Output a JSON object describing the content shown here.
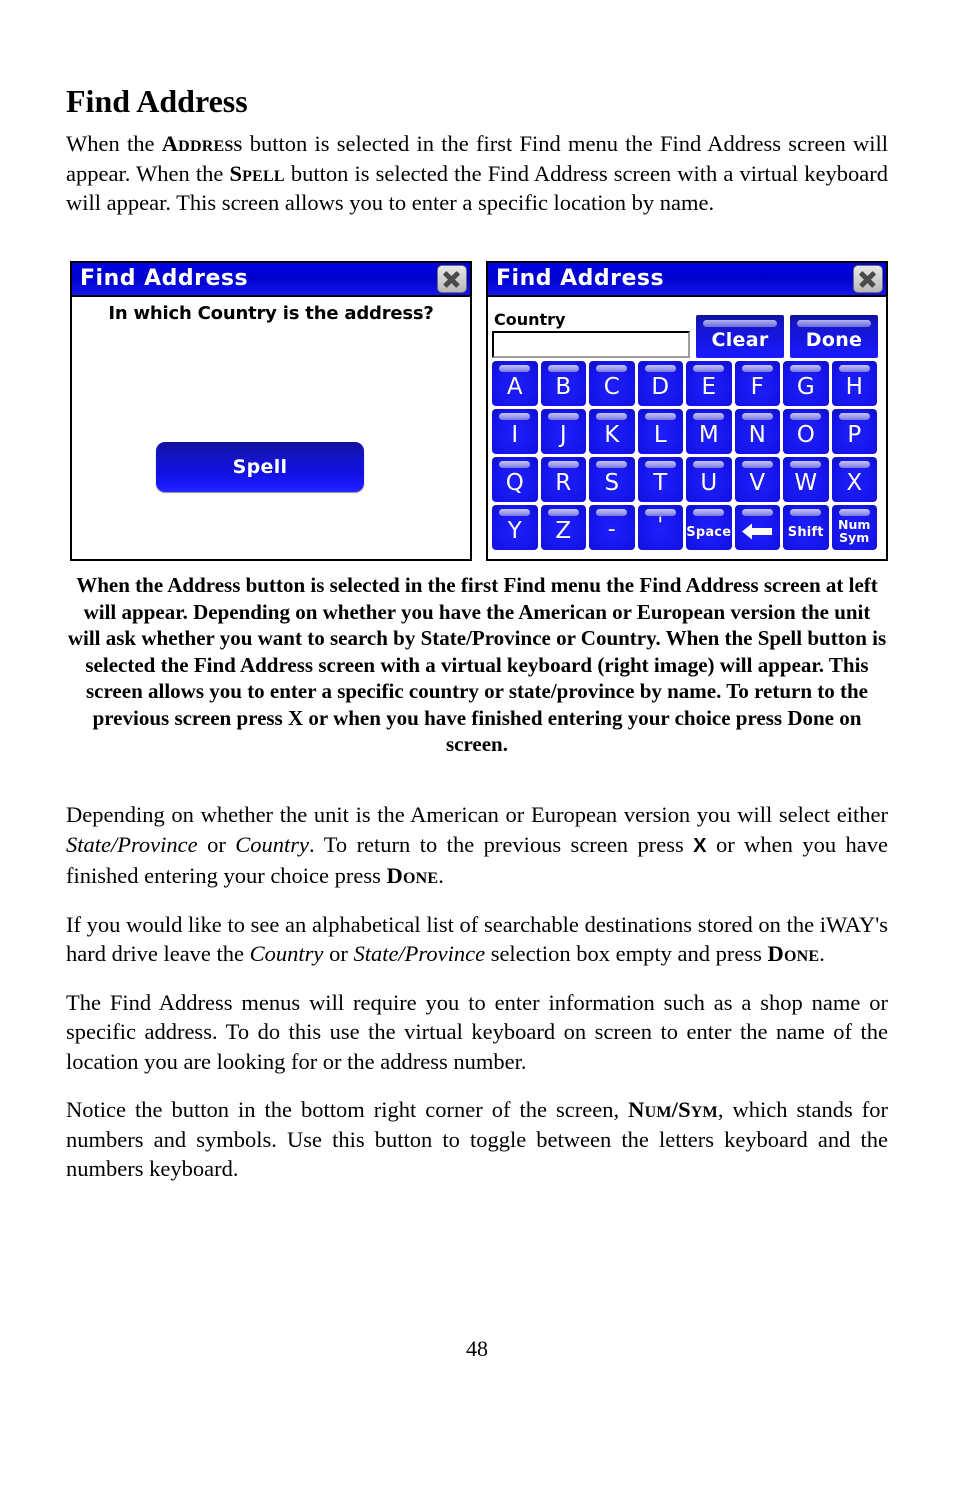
{
  "document": {
    "heading": "Find Address",
    "page_number": "48"
  },
  "intro_paragraph": {
    "part1": "When the ",
    "sc1": "Address",
    "part2": " button is selected in the first Find menu the Find Address screen will appear. When the ",
    "sc2": "Spell",
    "part3": " button is selected the Find Address screen with a virtual keyboard will appear. This screen allows you to enter a specific location by name."
  },
  "screenshot_left": {
    "title": "Find Address",
    "close_icon": "close-icon",
    "prompt": "In which Country is the address?",
    "spell_button": "Spell"
  },
  "screenshot_right": {
    "title": "Find Address",
    "close_icon": "close-icon",
    "field_label": "Country",
    "field_value": "",
    "clear_button": "Clear",
    "done_button": "Done",
    "keyboard_rows": [
      [
        "A",
        "B",
        "C",
        "D",
        "E",
        "F",
        "G",
        "H"
      ],
      [
        "I",
        "J",
        "K",
        "L",
        "M",
        "N",
        "O",
        "P"
      ],
      [
        "Q",
        "R",
        "S",
        "T",
        "U",
        "V",
        "W",
        "X"
      ]
    ],
    "bottom_row": [
      {
        "label": "Y",
        "type": "letter"
      },
      {
        "label": "Z",
        "type": "letter"
      },
      {
        "label": "-",
        "type": "dash"
      },
      {
        "label": "'",
        "type": "apos"
      },
      {
        "label": "Space",
        "type": "small"
      },
      {
        "label": "backspace-arrow-icon",
        "type": "arrow"
      },
      {
        "label": "Shift",
        "type": "small"
      },
      {
        "label": "Num\nSym",
        "type": "twoline",
        "line1": "Num",
        "line2": "Sym"
      }
    ]
  },
  "caption": "When the Address button is selected in the first Find menu the Find Address screen at left will appear. Depending on whether you have the American or European version the unit will ask whether you want to search by State/Province or Country. When the Spell button is selected the Find Address screen with a virtual keyboard (right image) will appear. This screen allows you to enter a specific country or state/province by name. To return to the previous screen press X or when you have finished entering your choice press Done on screen.",
  "paragraphs": {
    "p2": {
      "a": "Depending on whether the unit is the American or European version you will select either ",
      "i1": "State/Province",
      "b": " or ",
      "i2": "Country",
      "c": ". To return to the previous screen press ",
      "x": "X",
      "d": " or when you have finished entering your choice press ",
      "sc": "Done",
      "e": "."
    },
    "p3": {
      "a": "If you would like to see an alphabetical list of searchable destinations stored on the iWAY's hard drive leave the ",
      "i1": "Country",
      "b": " or ",
      "i2": "State/Province",
      "c": " selection box empty and press ",
      "sc": "Done",
      "d": "."
    },
    "p4": "The Find Address menus will require you to enter information such as a shop name or specific address. To do this use the virtual keyboard on screen to enter the name of the location you are looking for or the address number.",
    "p5": {
      "a": "Notice the button in the bottom right corner of the screen, ",
      "sc": "Num/Sym",
      "b": ", which stands for numbers and symbols. Use this button to toggle between the letters keyboard and the numbers keyboard."
    }
  },
  "colors": {
    "titlebar_blue": "#0000cc",
    "key_blue": "#1414e8",
    "key_edge": "#070757",
    "text_black": "#000000"
  }
}
